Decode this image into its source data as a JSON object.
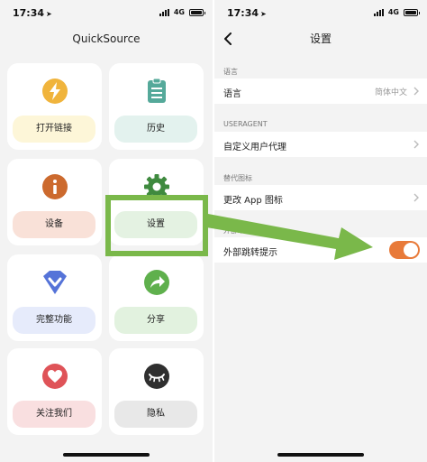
{
  "colors": {
    "accent_orange": "#e87a39",
    "annotation_green": "#7ab84a"
  },
  "left_screen": {
    "status": {
      "time": "17:34",
      "network": "4G"
    },
    "title": "QuickSource",
    "tiles": [
      {
        "label": "打开链接",
        "icon": "lightning-icon",
        "icon_color": "#f0b43c",
        "button_color": "#fdf6d8"
      },
      {
        "label": "历史",
        "icon": "clipboard-icon",
        "icon_color": "#55a99a",
        "button_color": "#e3f2ee"
      },
      {
        "label": "设备",
        "icon": "info-icon",
        "icon_color": "#cc6a2e",
        "button_color": "#f9e1d8"
      },
      {
        "label": "设置",
        "icon": "gear-icon",
        "icon_color": "#3f8a3f",
        "button_color": "#e4f2e2"
      },
      {
        "label": "完整功能",
        "icon": "chevron-badge-icon",
        "icon_color": "#5573d8",
        "button_color": "#e6ebfb"
      },
      {
        "label": "分享",
        "icon": "share-arrow-icon",
        "icon_color": "#5fb04d",
        "button_color": "#e2f2df"
      },
      {
        "label": "关注我们",
        "icon": "heart-icon",
        "icon_color": "#df5358",
        "button_color": "#f9dfe0"
      },
      {
        "label": "隐私",
        "icon": "closed-eye-icon",
        "icon_color": "#2f2f2f",
        "button_color": "#e8e8e8"
      }
    ]
  },
  "right_screen": {
    "status": {
      "time": "17:34",
      "network": "4G"
    },
    "title": "设置",
    "sections": [
      {
        "header": "语言",
        "row_label": "语言",
        "row_value": "简体中文"
      },
      {
        "header": "USERAGENT",
        "row_label": "自定义用户代理",
        "row_value": ""
      },
      {
        "header": "替代图标",
        "row_label": "更改 App 图标",
        "row_value": ""
      },
      {
        "header": "外部跳转提示",
        "row_label": "外部跳转提示",
        "toggle_on": true
      }
    ]
  }
}
